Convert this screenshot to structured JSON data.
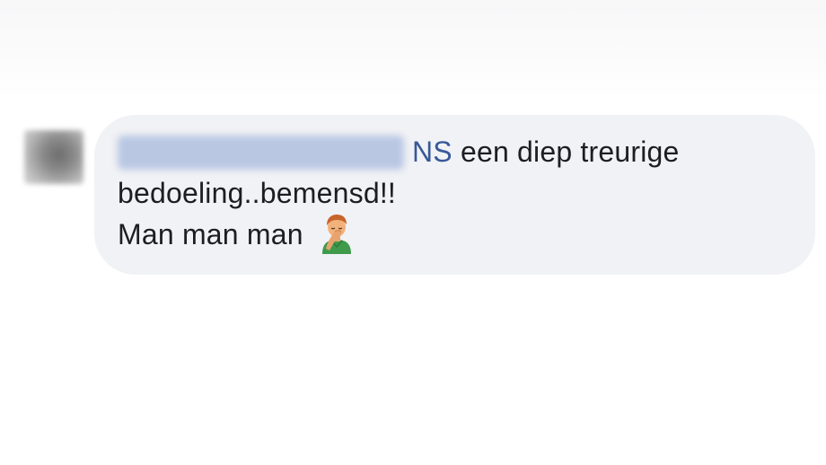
{
  "comment": {
    "author": "",
    "mention": "NS",
    "line1_text": " een diep treurige",
    "line2_text": "bedoeling..bemensd!!",
    "line3_text": "Man man man ",
    "emoji": "person-facepalming-emoji"
  },
  "colors": {
    "bubble_bg": "#f1f2f5",
    "mention": "#385898",
    "text": "#1c1e21"
  }
}
